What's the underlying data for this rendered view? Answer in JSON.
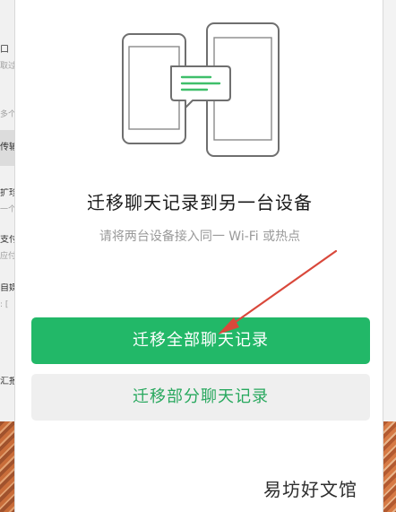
{
  "background": {
    "left_panel": {
      "fragments": [
        "口",
        "取过",
        "多个",
        "传输",
        "扩珍",
        "一个",
        "支付",
        "应付",
        "自媒",
        ": [",
        "汇报"
      ]
    }
  },
  "dialog": {
    "illustration": {
      "icons": [
        "phone-left-icon",
        "phone-right-icon",
        "chat-bubble-icon"
      ]
    },
    "title": "迁移聊天记录到另一台设备",
    "subtitle": "请将两台设备接入同一 Wi-Fi 或热点",
    "primary_button": "迁移全部聊天记录",
    "secondary_button": "迁移部分聊天记录"
  },
  "watermark": "易坊好文馆",
  "colors": {
    "accent_green": "#22b868",
    "secondary_bg": "#efefef",
    "secondary_text": "#28a85e",
    "annotation_arrow": "#d9483b"
  }
}
